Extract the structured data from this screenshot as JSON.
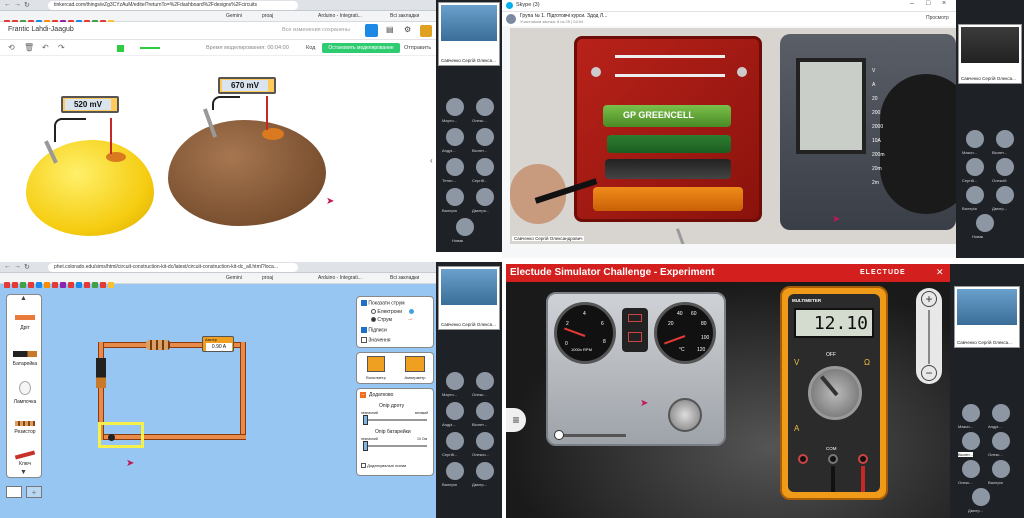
{
  "tinkercad": {
    "url": "tinkercad.com/things/eZg3CYzAuM/editel?returnTo=%2Fdashboard%2Fdesigns%2Fcircuits",
    "bookmarks": [
      "Gemini",
      "proaj",
      "Arduino - Integrаti...",
      "Всі закладки"
    ],
    "project_title": "Frantic Lahdi-Jaagub",
    "saved_status": "Все изменения сохранены",
    "sim_time_label": "Время моделирования: 00:04:00",
    "code_label": "Код",
    "stop_button": "Остановить моделирование",
    "send_button": "Отправить",
    "lemon_meter": "520 mV",
    "potato_meter": "670 mV"
  },
  "skype": {
    "window_title": "Skype (3)",
    "call_title": "Група № 1. Підготовчі курси. Здод Л...",
    "call_sub": "Участников звонка: 8 из 25 | 04:04",
    "view_label": "Просмотр",
    "video_label": "Савченко Сергій Олександрович",
    "battery_brand": "GP GREENCELL",
    "meter_scale_labels": [
      "V",
      "A",
      "20",
      "200",
      "2000",
      "10A",
      "200m",
      "20m",
      "2m"
    ]
  },
  "phet": {
    "url": "phet.colorado.edu/sims/html/circuit-construction-kit-dc/latest/circuit-construction-kit-dc_all.html?loca...",
    "palette": [
      "Дріт",
      "Батарейка",
      "Лампочка",
      "Резистор",
      "Ключ"
    ],
    "show_current_label": "Показати струм",
    "electrons_label": "Електрони",
    "current_label": "Струм",
    "labels_label": "Підписи",
    "values_label": "Значення",
    "voltmeter_label": "Вольтметр",
    "ammeter_label": "Амперметр",
    "advanced_label": "Додатково",
    "wire_resistance_label": "Опір дроту",
    "battery_resistance_label": "Опір батарейки",
    "slider_low": "незначний",
    "slider_high": "великий",
    "slider_high2": "10 Ом",
    "extra_checkbox": "Додаткувальні линии",
    "ammeter_tag": "Ампер",
    "ammeter_value": "0.90 A"
  },
  "electude": {
    "title": "Electude Simulator Challenge - Experiment",
    "brand": "ELECTUDE",
    "multimeter_title": "MULTIMETER",
    "multimeter_reading": "12.10",
    "rpm_label": "1000x RPM",
    "temp_label": "°C",
    "dial_off": "OFF",
    "com_label": "COM",
    "volt_label": "V",
    "amp_label": "A",
    "ohm_label": "Ω",
    "gauge_ticks_rpm": [
      "0",
      "2",
      "4",
      "6",
      "8"
    ],
    "gauge_ticks_temp": [
      "20",
      "40",
      "60",
      "80",
      "100",
      "120"
    ]
  },
  "participants": {
    "presenter_name": "Савченко Сергій Олекса...",
    "q1": [
      "Марто...",
      "Олекс...",
      "Андрі...",
      "Віолет...",
      "Тетян...",
      "Сергій...",
      "Валерія",
      "Дмитро...",
      "Новак"
    ],
    "q2": [
      "Макси...",
      "Віолет...",
      "Сергій...",
      "Олексій",
      "Валерія",
      "Дмитр...",
      "Новак"
    ],
    "q3": [
      "Марто...",
      "Олекс...",
      "Андрі...",
      "Віолет...",
      "Сергій...",
      "Олекси...",
      "Валерія",
      "Дмитр..."
    ],
    "q4": [
      "Макси...",
      "Андрі...",
      "Віолет...",
      "Олекс...",
      "Олекс...",
      "Валерія",
      "Дмитр..."
    ],
    "q4_active": "Віолет..."
  }
}
